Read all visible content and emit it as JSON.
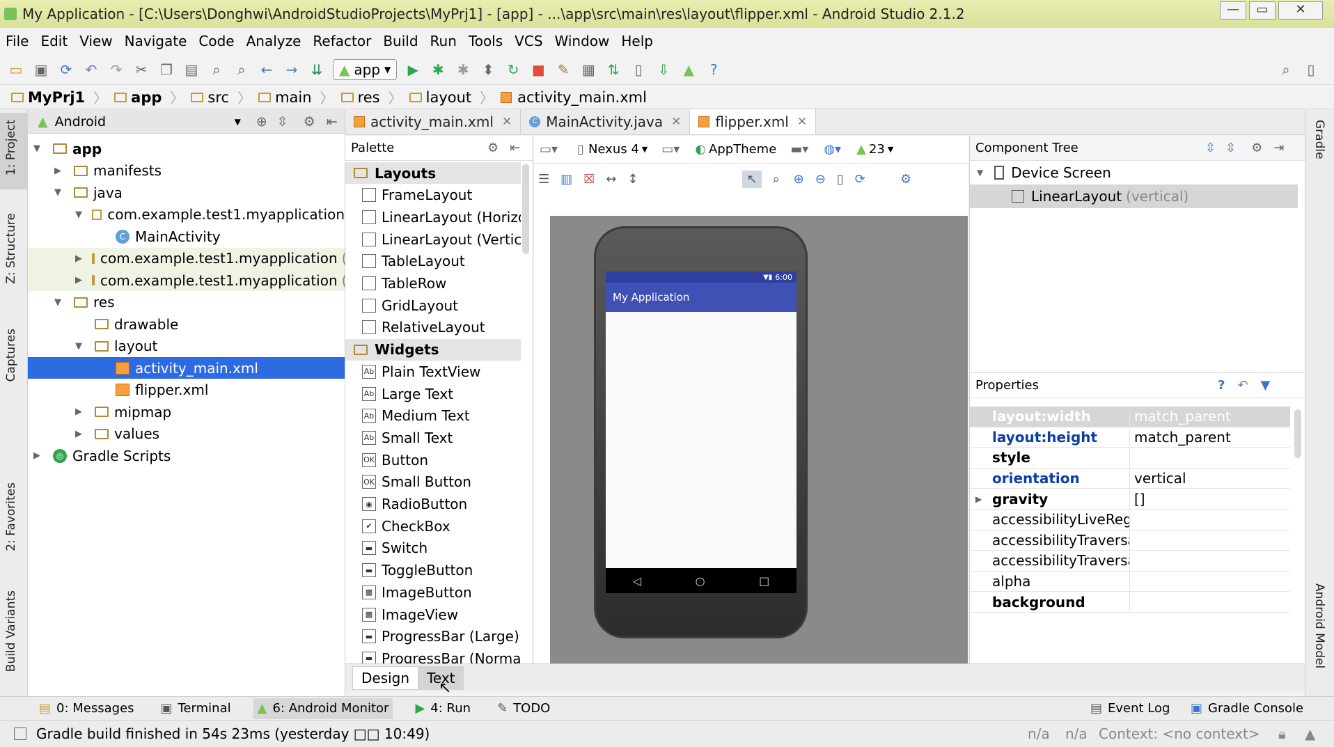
{
  "window": {
    "title": "My Application - [C:\\Users\\Donghwi\\AndroidStudioProjects\\MyPrj1] - [app] - ...\\app\\src\\main\\res\\layout\\flipper.xml - Android Studio 2.1.2"
  },
  "menu": [
    "File",
    "Edit",
    "View",
    "Navigate",
    "Code",
    "Analyze",
    "Refactor",
    "Build",
    "Run",
    "Tools",
    "VCS",
    "Window",
    "Help"
  ],
  "toolbar": {
    "run_config": "app"
  },
  "breadcrumbs": [
    "MyPrj1",
    "app",
    "src",
    "main",
    "res",
    "layout",
    "activity_main.xml"
  ],
  "left_strip": {
    "project": "1: Project",
    "structure": "Z: Structure",
    "captures": "Captures",
    "favorites": "2: Favorites",
    "build_variants": "Build Variants"
  },
  "right_strip": {
    "gradle": "Gradle",
    "android_model": "Android Model"
  },
  "project_panel": {
    "view": "Android",
    "tree": [
      {
        "label": "app",
        "depth": 0,
        "expanded": true,
        "type": "module",
        "bold": true
      },
      {
        "label": "manifests",
        "depth": 1,
        "expanded": false,
        "type": "folder"
      },
      {
        "label": "java",
        "depth": 1,
        "expanded": true,
        "type": "folder"
      },
      {
        "label": "com.example.test1.myapplication",
        "depth": 2,
        "expanded": true,
        "type": "package"
      },
      {
        "label": "MainActivity",
        "depth": 3,
        "type": "class"
      },
      {
        "label": "com.example.test1.myapplication",
        "suffix": "(a",
        "depth": 2,
        "expanded": false,
        "type": "package"
      },
      {
        "label": "com.example.test1.myapplication",
        "suffix": "(te",
        "depth": 2,
        "expanded": false,
        "type": "package"
      },
      {
        "label": "res",
        "depth": 1,
        "expanded": true,
        "type": "folder"
      },
      {
        "label": "drawable",
        "depth": 2,
        "type": "folder"
      },
      {
        "label": "layout",
        "depth": 2,
        "expanded": true,
        "type": "folder"
      },
      {
        "label": "activity_main.xml",
        "depth": 3,
        "type": "xml",
        "selected": true
      },
      {
        "label": "flipper.xml",
        "depth": 3,
        "type": "xml"
      },
      {
        "label": "mipmap",
        "depth": 2,
        "expanded": false,
        "type": "folder"
      },
      {
        "label": "values",
        "depth": 2,
        "expanded": false,
        "type": "folder"
      },
      {
        "label": "Gradle Scripts",
        "depth": 0,
        "expanded": false,
        "type": "gradle"
      }
    ]
  },
  "editor_tabs": [
    {
      "label": "activity_main.xml",
      "active": false
    },
    {
      "label": "MainActivity.java",
      "active": false
    },
    {
      "label": "flipper.xml",
      "active": true
    }
  ],
  "palette": {
    "title": "Palette",
    "layouts_header": "Layouts",
    "layouts": [
      "FrameLayout",
      "LinearLayout (Horizon",
      "LinearLayout (Vertical",
      "TableLayout",
      "TableRow",
      "GridLayout",
      "RelativeLayout"
    ],
    "widgets_header": "Widgets",
    "widgets": [
      "Plain TextView",
      "Large Text",
      "Medium Text",
      "Small Text",
      "Button",
      "Small Button",
      "RadioButton",
      "CheckBox",
      "Switch",
      "ToggleButton",
      "ImageButton",
      "ImageView",
      "ProgressBar (Large)",
      "ProgressBar (Normal)"
    ]
  },
  "design_toolbar": {
    "device": "Nexus 4",
    "theme": "AppTheme",
    "api": "23"
  },
  "device_preview": {
    "app_title": "My Application",
    "time": "6:00"
  },
  "component_tree": {
    "title": "Component Tree",
    "root": "Device Screen",
    "child": "LinearLayout",
    "child_suffix": "(vertical)"
  },
  "properties": {
    "title": "Properties",
    "rows": [
      {
        "name": "layout:width",
        "value": "match_parent",
        "style": "selected"
      },
      {
        "name": "layout:height",
        "value": "match_parent",
        "style": "blue"
      },
      {
        "name": "style",
        "value": "",
        "style": "bold"
      },
      {
        "name": "orientation",
        "value": "vertical",
        "style": "blue"
      },
      {
        "name": "gravity",
        "value": "[]",
        "style": "bold",
        "expandable": true
      },
      {
        "name": "accessibilityLiveRegion",
        "value": "",
        "style": "normal"
      },
      {
        "name": "accessibilityTraversalA",
        "value": "",
        "style": "normal"
      },
      {
        "name": "accessibilityTraversalB",
        "value": "",
        "style": "normal"
      },
      {
        "name": "alpha",
        "value": "",
        "style": "normal"
      },
      {
        "name": "background",
        "value": "",
        "style": "bold"
      }
    ]
  },
  "bottom_tabs": [
    {
      "label": "Design",
      "active": true
    },
    {
      "label": "Text",
      "active": false
    }
  ],
  "tool_windows": [
    {
      "label": "0: Messages"
    },
    {
      "label": "Terminal"
    },
    {
      "label": "6: Android Monitor",
      "active": true
    },
    {
      "label": "4: Run"
    },
    {
      "label": "TODO"
    }
  ],
  "tool_windows_right": [
    {
      "label": "Event Log"
    },
    {
      "label": "Gradle Console"
    }
  ],
  "status": {
    "message": "Gradle build finished in 54s 23ms (yesterday □□ 10:49)",
    "pos1": "n/a",
    "pos2": "n/a",
    "context": "Context: <no context>"
  },
  "colors": {
    "selection": "#2d6be3",
    "accent_blue": "#0b3da2",
    "appbar": "#3f51b5",
    "statusbar": "#303f9f"
  }
}
